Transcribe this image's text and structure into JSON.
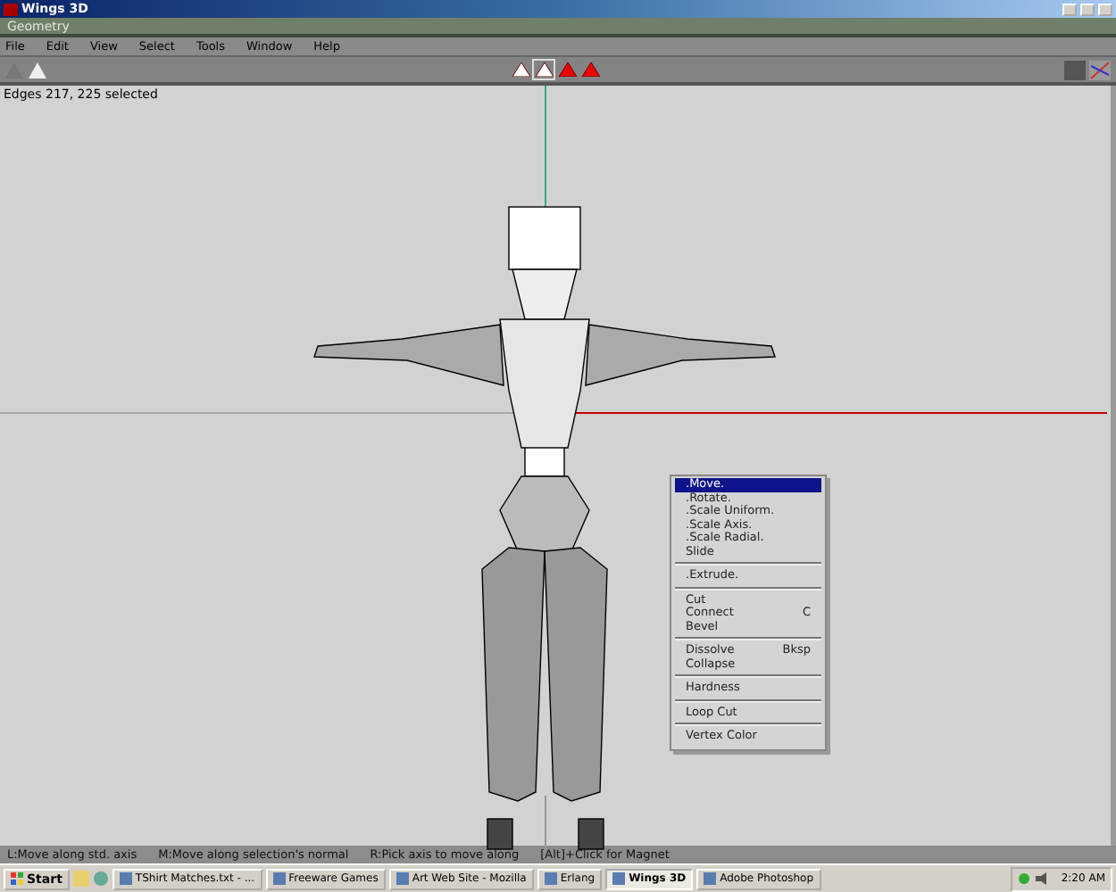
{
  "window": {
    "title": "Wings 3D"
  },
  "geometry_bar": {
    "title": "Geometry"
  },
  "menu_bar": [
    "File",
    "Edit",
    "View",
    "Select",
    "Tools",
    "Window",
    "Help"
  ],
  "selection_modes": [
    {
      "selected": false
    },
    {
      "selected": true
    },
    {
      "selected": false
    },
    {
      "selected": false
    }
  ],
  "viewport": {
    "info": "Edges 217, 225 selected"
  },
  "context_menu": [
    {
      "kind": "item",
      "label": ".Move.",
      "selected": true
    },
    {
      "kind": "item",
      "label": ".Rotate.",
      "selected": false
    },
    {
      "kind": "item",
      "label": ".Scale Uniform.",
      "selected": false
    },
    {
      "kind": "item",
      "label": ".Scale Axis.",
      "selected": false
    },
    {
      "kind": "item",
      "label": ".Scale Radial.",
      "selected": false
    },
    {
      "kind": "item",
      "label": "Slide",
      "selected": false
    },
    {
      "kind": "separator"
    },
    {
      "kind": "item",
      "label": ".Extrude.",
      "selected": false
    },
    {
      "kind": "separator"
    },
    {
      "kind": "item",
      "label": "Cut",
      "selected": false
    },
    {
      "kind": "item",
      "label": "Connect",
      "shortcut": "C",
      "selected": false
    },
    {
      "kind": "item",
      "label": "Bevel",
      "selected": false
    },
    {
      "kind": "separator"
    },
    {
      "kind": "item",
      "label": "Dissolve",
      "shortcut": "Bksp",
      "selected": false
    },
    {
      "kind": "item",
      "label": "Collapse",
      "selected": false
    },
    {
      "kind": "separator"
    },
    {
      "kind": "item",
      "label": "Hardness",
      "selected": false
    },
    {
      "kind": "separator"
    },
    {
      "kind": "item",
      "label": "Loop Cut",
      "selected": false
    },
    {
      "kind": "separator"
    },
    {
      "kind": "item",
      "label": "Vertex Color",
      "selected": false
    }
  ],
  "status_bar": [
    "L:Move along std. axis",
    "M:Move along selection's normal",
    "R:Pick axis to move along",
    "[Alt]+Click for Magnet"
  ],
  "taskbar": {
    "start": "Start",
    "buttons": [
      {
        "label": "TShirt Matches.txt - ...",
        "selected": false
      },
      {
        "label": "Freeware Games",
        "selected": false
      },
      {
        "label": "Art Web Site - Mozilla",
        "selected": false
      },
      {
        "label": "Erlang",
        "selected": false
      },
      {
        "label": "Wings 3D",
        "selected": true
      },
      {
        "label": "Adobe Photoshop",
        "selected": false
      }
    ],
    "clock": "2:20 AM"
  }
}
